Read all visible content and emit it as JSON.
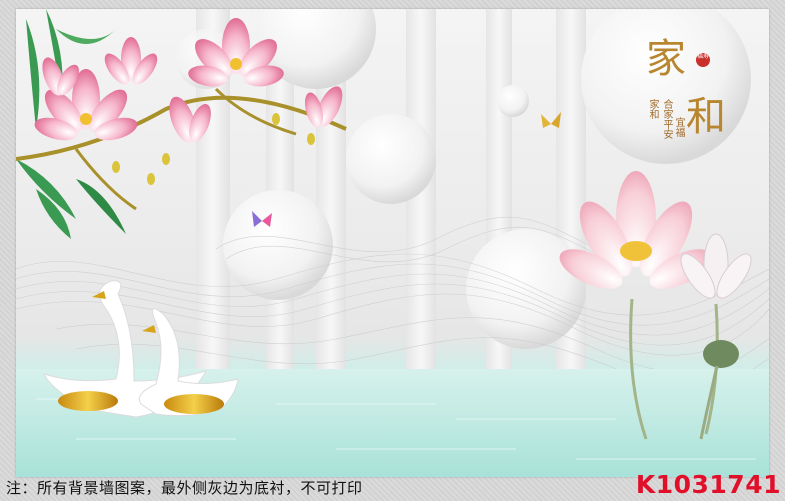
{
  "artwork": {
    "theme": "magnolia-lotus-swans-mural",
    "calligraphy": {
      "main_char_1": "家",
      "main_char_2": "和",
      "side_text_left": "家和",
      "side_text_mid": "合家平安",
      "side_text_right": "宜福",
      "seal_text": "福寿"
    }
  },
  "footer": {
    "note": "注：所有背景墙图案，最外侧灰边为底衬，不可打印",
    "product_code": "K1031741"
  },
  "colors": {
    "product_code": "#e0102a",
    "water": "#bfe9e2",
    "calligraphy_gold": "#b8862f"
  }
}
